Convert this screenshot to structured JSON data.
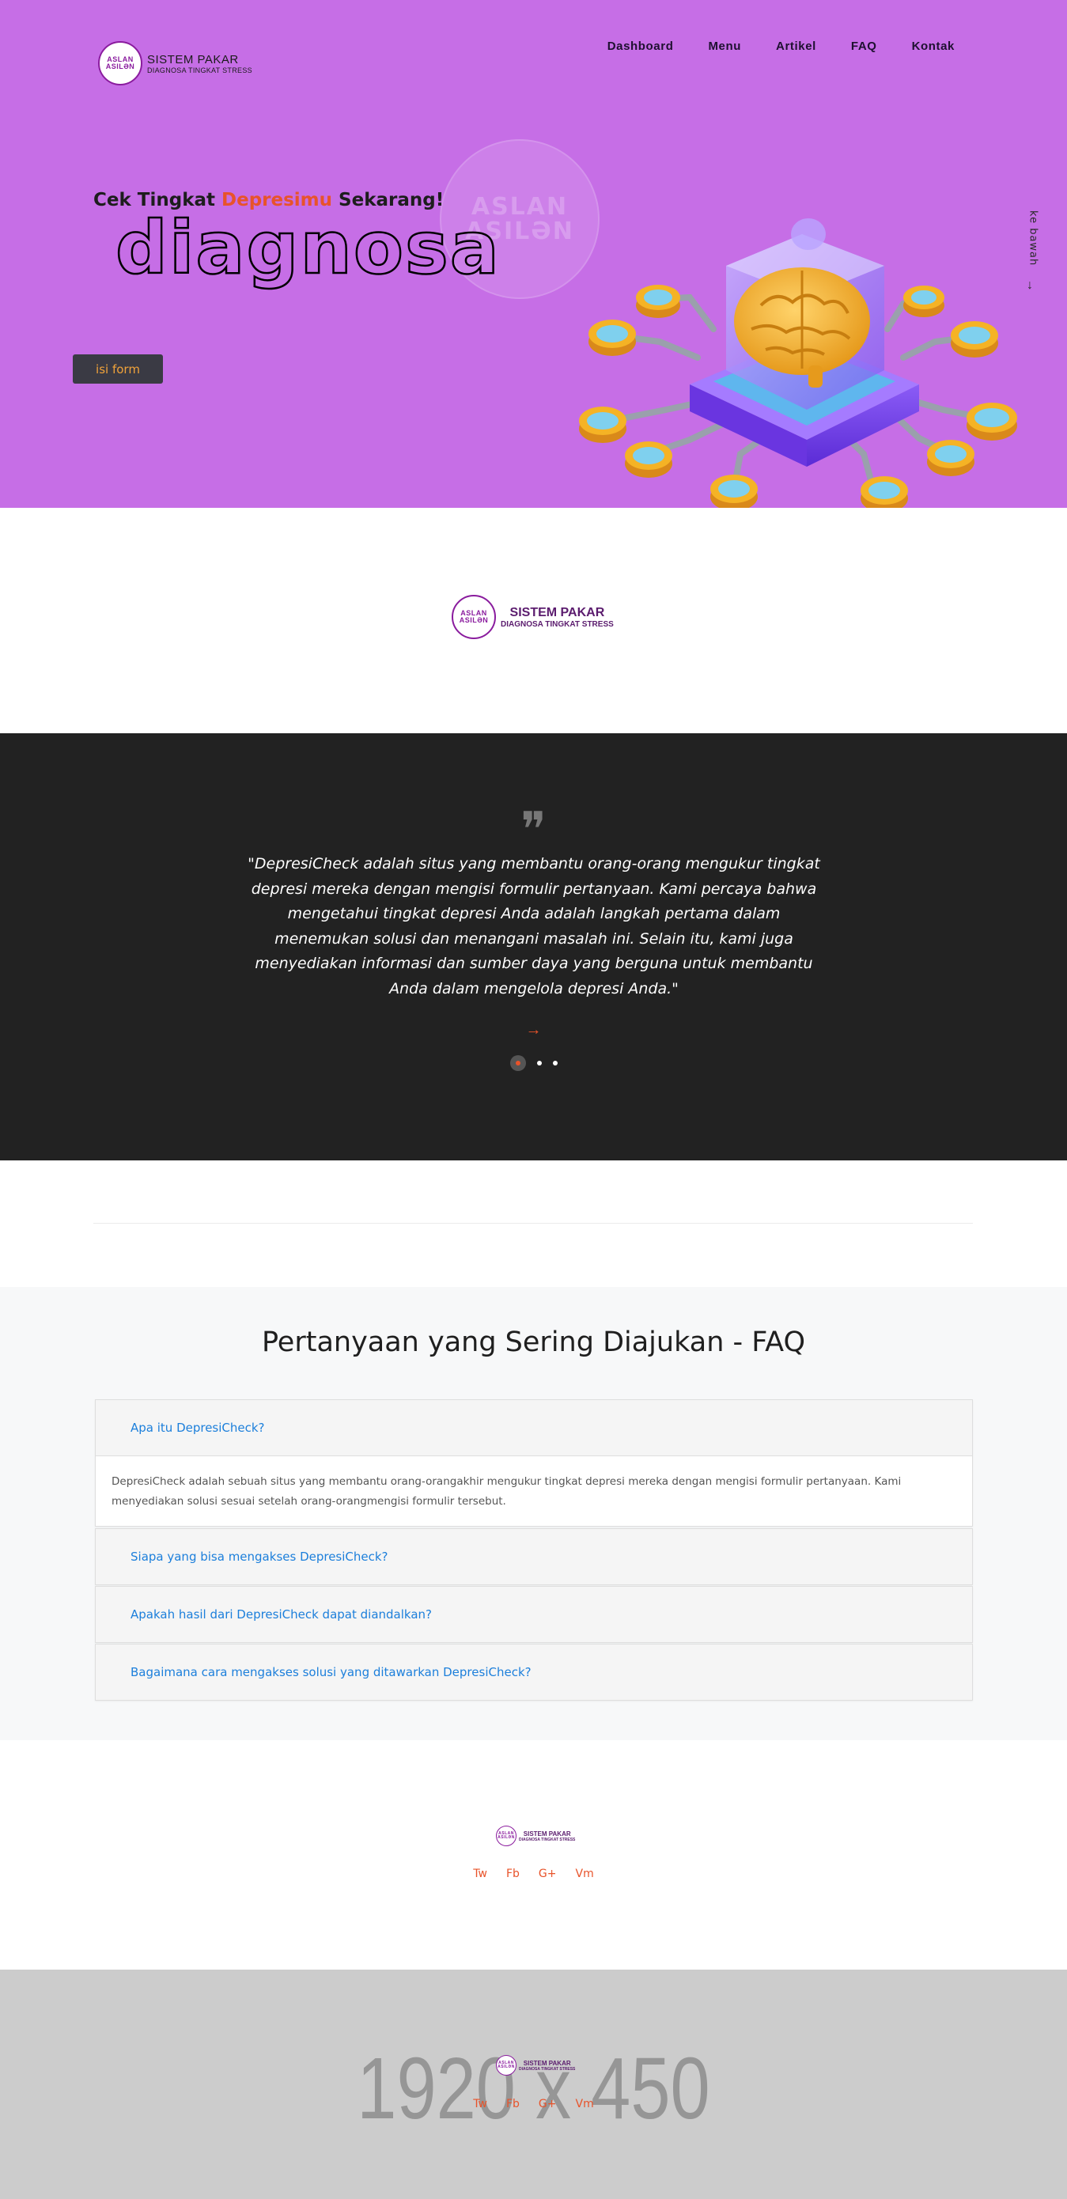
{
  "brand": {
    "title": "SISTEM PAKAR",
    "subtitle": "DIAGNOSA TINGKAT STRESS",
    "logo_top": "ASLAN",
    "logo_bottom": "ASILƏN"
  },
  "nav": {
    "items": [
      "Dashboard",
      "Menu",
      "Artikel",
      "FAQ",
      "Kontak"
    ]
  },
  "hero": {
    "headline_pre": "Cek Tingkat ",
    "headline_accent": "Depresimu",
    "headline_post": " Sekarang!",
    "big_word": "diagnosa",
    "watermark_top": "ASLAN",
    "watermark_bottom": "ASILƏN",
    "button_label": "isi form",
    "scroll_label": "ke bawah",
    "scroll_arrow": "⟶"
  },
  "quote": {
    "mark": "❞",
    "text": "\"DepresiCheck adalah situs yang membantu orang-orang mengukur tingkat depresi mereka dengan mengisi formulir pertanyaan. Kami percaya bahwa mengetahui tingkat depresi Anda adalah langkah pertama dalam menemukan solusi dan menangani masalah ini. Selain itu, kami juga menyediakan informasi dan sumber daya yang berguna untuk membantu Anda dalam mengelola depresi Anda.\"",
    "next_arrow": "→",
    "slide_count": 3,
    "active_slide": 1
  },
  "faq": {
    "title": "Pertanyaan yang Sering Diajukan - FAQ",
    "items": [
      {
        "question": "Apa itu DepresiCheck?",
        "answer": "DepresiCheck adalah sebuah situs yang membantu orang-orangakhir mengukur tingkat depresi mereka dengan mengisi formulir pertanyaan. Kami menyediakan solusi sesuai setelah orang-orangmengisi formulir tersebut.",
        "expanded": true
      },
      {
        "question": "Siapa yang bisa mengakses DepresiCheck?",
        "expanded": false
      },
      {
        "question": "Apakah hasil dari DepresiCheck dapat diandalkan?",
        "expanded": false
      },
      {
        "question": "Bagaimana cara mengakses solusi yang ditawarkan DepresiCheck?",
        "expanded": false
      }
    ]
  },
  "footer": {
    "social": [
      "Tw",
      "Fb",
      "G+",
      "Vm"
    ]
  },
  "placeholder": {
    "label": "1920 x 450"
  },
  "colors": {
    "hero_bg": "#c66ee6",
    "accent_orange": "#e8532a",
    "quote_bg": "#222222",
    "faq_link": "#1c7fdb",
    "brand_purple": "#8a1c9e"
  }
}
